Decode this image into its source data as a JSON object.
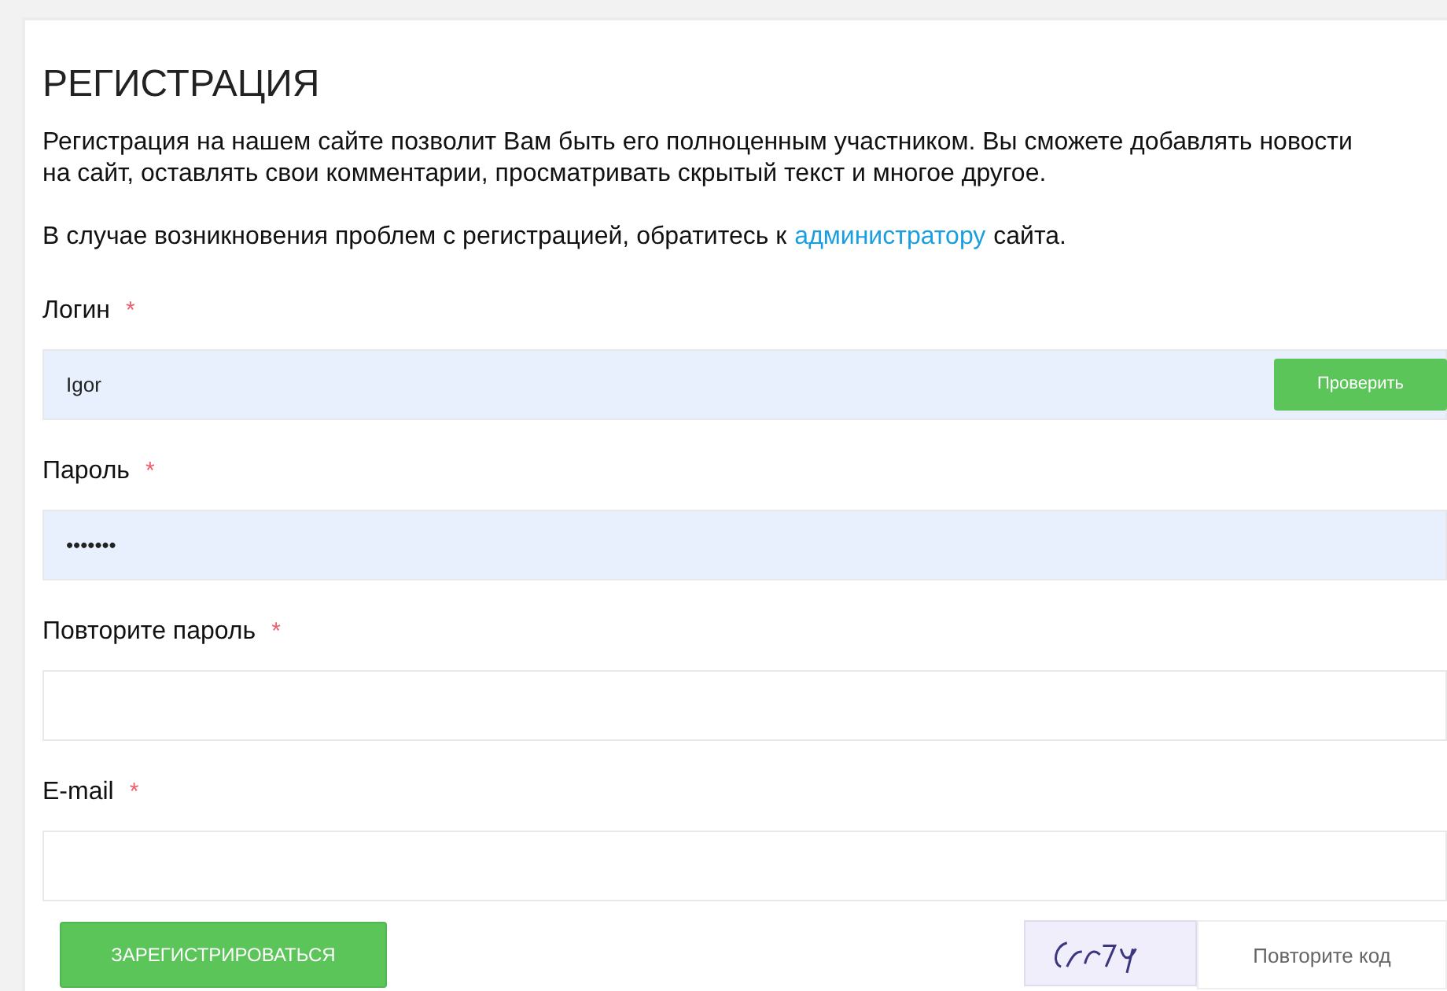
{
  "title": "РЕГИСТРАЦИЯ",
  "intro": "Регистрация на нашем сайте позволит Вам быть его полноценным участником. Вы сможете добавлять новости на сайт, оставлять свои комментарии, просматривать скрытый текст и многое другое.",
  "help": {
    "before": "В случае возникновения проблем с регистрацией, обратитесь к",
    "link": "администратору",
    "after": "сайта."
  },
  "fields": [
    {
      "label": "Логин",
      "required_mark": "*",
      "value": "Igor",
      "autofilled": true,
      "button": "Проверить"
    },
    {
      "label": "Пароль",
      "required_mark": "*",
      "value": "•••••••",
      "autofilled": true
    },
    {
      "label": "Повторите пароль",
      "required_mark": "*",
      "autofilled": false
    },
    {
      "label": "E-mail",
      "required_mark": "*",
      "autofilled": false
    }
  ],
  "submit": "ЗАРЕГИСТРИРОВАТЬСЯ",
  "captcha": {
    "placeholder": "Повторите код"
  }
}
